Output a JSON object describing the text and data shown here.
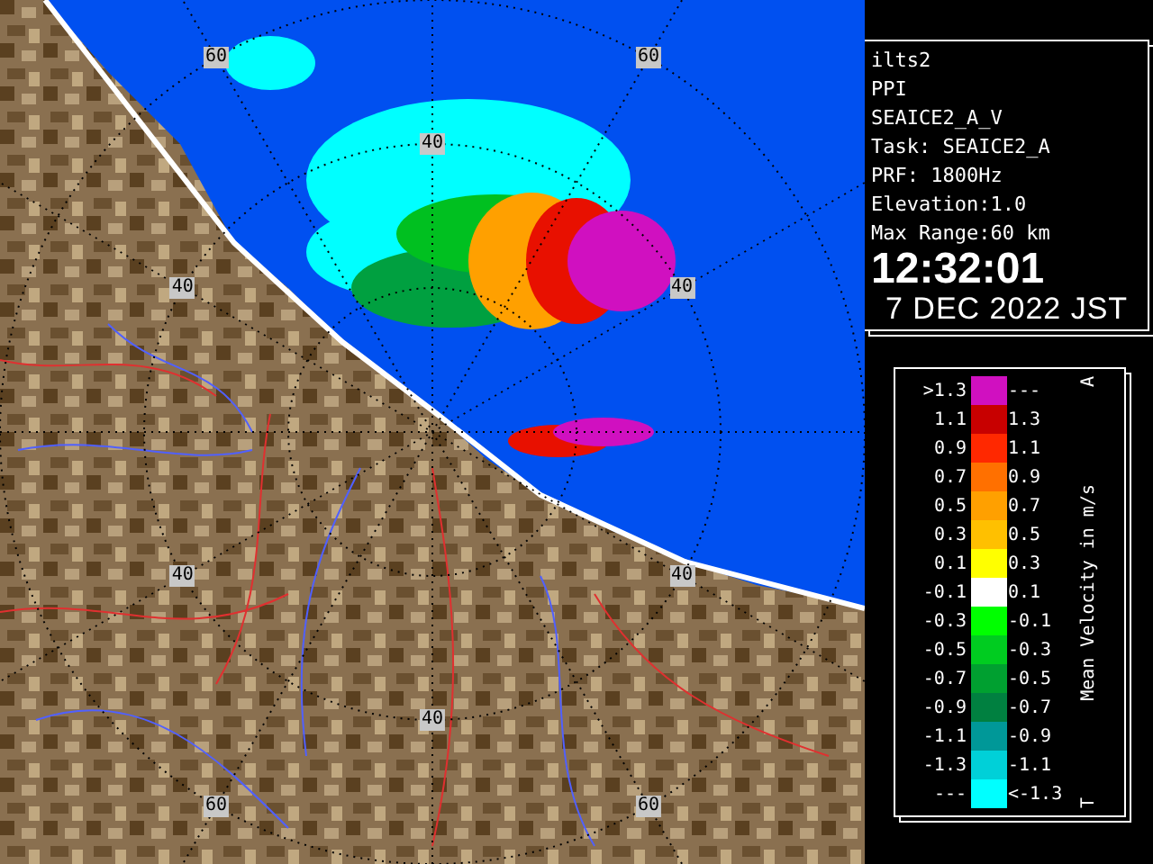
{
  "map": {
    "range_labels": [
      "60",
      "60",
      "40",
      "40",
      "40",
      "40",
      "40",
      "40",
      "60",
      "60"
    ]
  },
  "info": {
    "lines": [
      "ilts2",
      "PPI",
      "SEAICE2_A_V",
      "Task: SEAICE2_A",
      "PRF: 1800Hz",
      "Elevation:1.0",
      "Max Range:60 km"
    ],
    "time": "12:32:01",
    "date": "7 DEC 2022 JST"
  },
  "legend": {
    "title": "Mean Velocity in m/s",
    "top_mark": "A",
    "bottom_mark": "T",
    "rows": [
      {
        "low": ">1.3",
        "high": "---",
        "color": "#d010c0"
      },
      {
        "low": "1.1",
        "high": "1.3",
        "color": "#c80000"
      },
      {
        "low": "0.9",
        "high": "1.1",
        "color": "#ff2800"
      },
      {
        "low": "0.7",
        "high": "0.9",
        "color": "#ff7000"
      },
      {
        "low": "0.5",
        "high": "0.7",
        "color": "#ffa000"
      },
      {
        "low": "0.3",
        "high": "0.5",
        "color": "#ffc000"
      },
      {
        "low": "0.1",
        "high": "0.3",
        "color": "#ffff00"
      },
      {
        "low": "-0.1",
        "high": "0.1",
        "color": "#ffffff"
      },
      {
        "low": "-0.3",
        "high": "-0.1",
        "color": "#00ff00"
      },
      {
        "low": "-0.5",
        "high": "-0.3",
        "color": "#00cc20"
      },
      {
        "low": "-0.7",
        "high": "-0.5",
        "color": "#00a030"
      },
      {
        "low": "-0.9",
        "high": "-0.7",
        "color": "#008040"
      },
      {
        "low": "-1.1",
        "high": "-0.9",
        "color": "#009898"
      },
      {
        "low": "-1.3",
        "high": "-1.1",
        "color": "#00d0d8"
      },
      {
        "low": "---",
        "high": "<-1.3",
        "color": "#00ffff"
      }
    ]
  }
}
